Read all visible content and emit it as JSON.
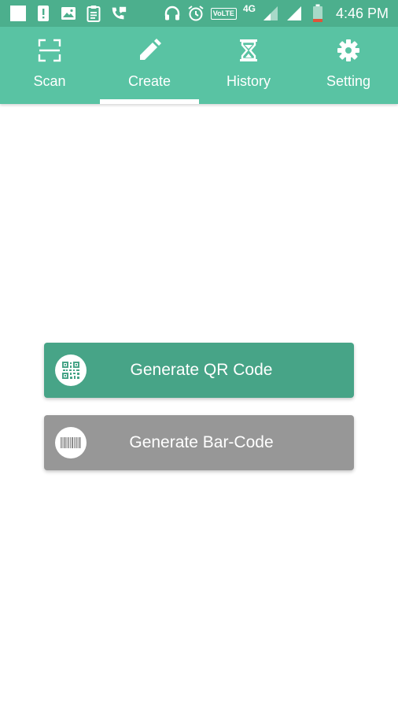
{
  "status_bar": {
    "network_type": "4G",
    "volte_label": "VoLTE",
    "time": "4:46 PM"
  },
  "tabs": [
    {
      "label": "Scan",
      "icon": "scan-frame-icon",
      "selected": false
    },
    {
      "label": "Create",
      "icon": "pencil-icon",
      "selected": true
    },
    {
      "label": "History",
      "icon": "hourglass-icon",
      "selected": false
    },
    {
      "label": "Setting",
      "icon": "gear-icon",
      "selected": false
    }
  ],
  "actions": {
    "qr": {
      "label": "Generate QR Code",
      "icon": "qr-code-icon"
    },
    "barcode": {
      "label": "Generate Bar-Code",
      "icon": "barcode-icon"
    }
  },
  "colors": {
    "status_bar": "#4caf8d",
    "tab_bar": "#59c3a3",
    "qr_button": "#47a487",
    "barcode_button": "#979797"
  }
}
